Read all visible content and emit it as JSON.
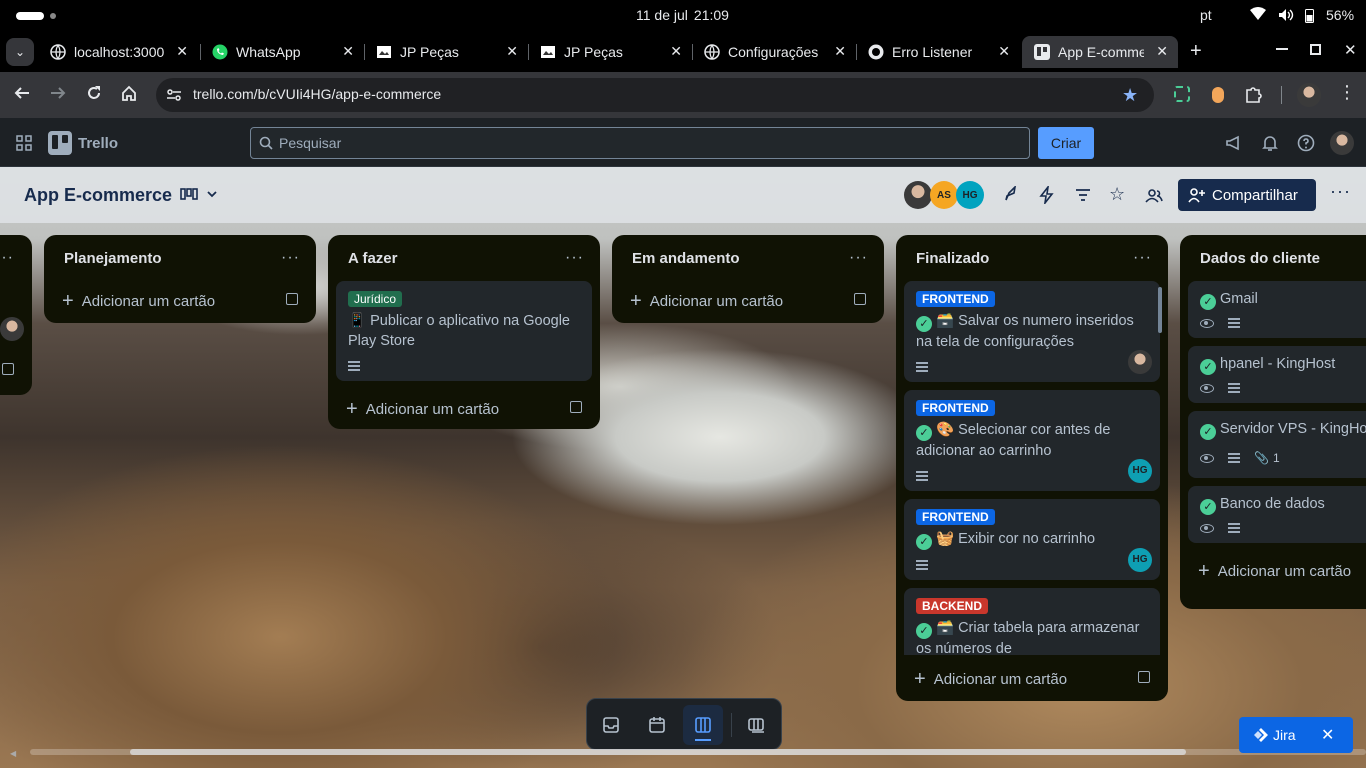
{
  "os": {
    "date": "11 de jul",
    "time": "21:09",
    "lang": "pt",
    "battery": "56%"
  },
  "tabs": [
    {
      "title": "localhost:3000",
      "icon": "globe-icon"
    },
    {
      "title": "WhatsApp",
      "icon": "whatsapp-icon"
    },
    {
      "title": "JP Peças",
      "icon": "page-icon"
    },
    {
      "title": "JP Peças",
      "icon": "page-icon"
    },
    {
      "title": "Configurações",
      "icon": "globe-icon"
    },
    {
      "title": "Erro Listener",
      "icon": "github-icon"
    },
    {
      "title": "App E-commerce",
      "icon": "trello-icon",
      "active": true
    }
  ],
  "browser": {
    "url": "trello.com/b/cVUIi4HG/app-e-commerce"
  },
  "trello": {
    "logo": "Trello",
    "search_placeholder": "Pesquisar",
    "create": "Criar"
  },
  "board": {
    "title": "App E-commerce",
    "members": [
      "AS",
      "HG"
    ],
    "share": "Compartilhar",
    "add_card": "Adicionar um cartão",
    "lists": {
      "planning": {
        "title": "Planejamento"
      },
      "todo": {
        "title": "A fazer",
        "card": {
          "label": "Jurídico",
          "text": "📱 Publicar o aplicativo na Google Play Store"
        }
      },
      "doing": {
        "title": "Em andamento"
      },
      "done": {
        "title": "Finalizado",
        "cards": [
          {
            "label": "FRONTEND",
            "text": "🗃️ Salvar os numero inseridos na tela de configurações"
          },
          {
            "label": "FRONTEND",
            "text": "🎨 Selecionar cor antes de adicionar ao carrinho",
            "member": "HG"
          },
          {
            "label": "FRONTEND",
            "text": "🧺 Exibir cor no carrinho",
            "member": "HG"
          },
          {
            "label": "BACKEND",
            "text": "🗃️ Criar tabela para armazenar os números de"
          }
        ]
      },
      "client": {
        "title": "Dados do cliente",
        "cards": [
          {
            "text": "Gmail"
          },
          {
            "text": "hpanel - KingHost"
          },
          {
            "text": "Servidor VPS - KingHost",
            "attachments": "1"
          },
          {
            "text": "Banco de dados"
          }
        ]
      }
    }
  },
  "jira": {
    "label": "Jira"
  }
}
